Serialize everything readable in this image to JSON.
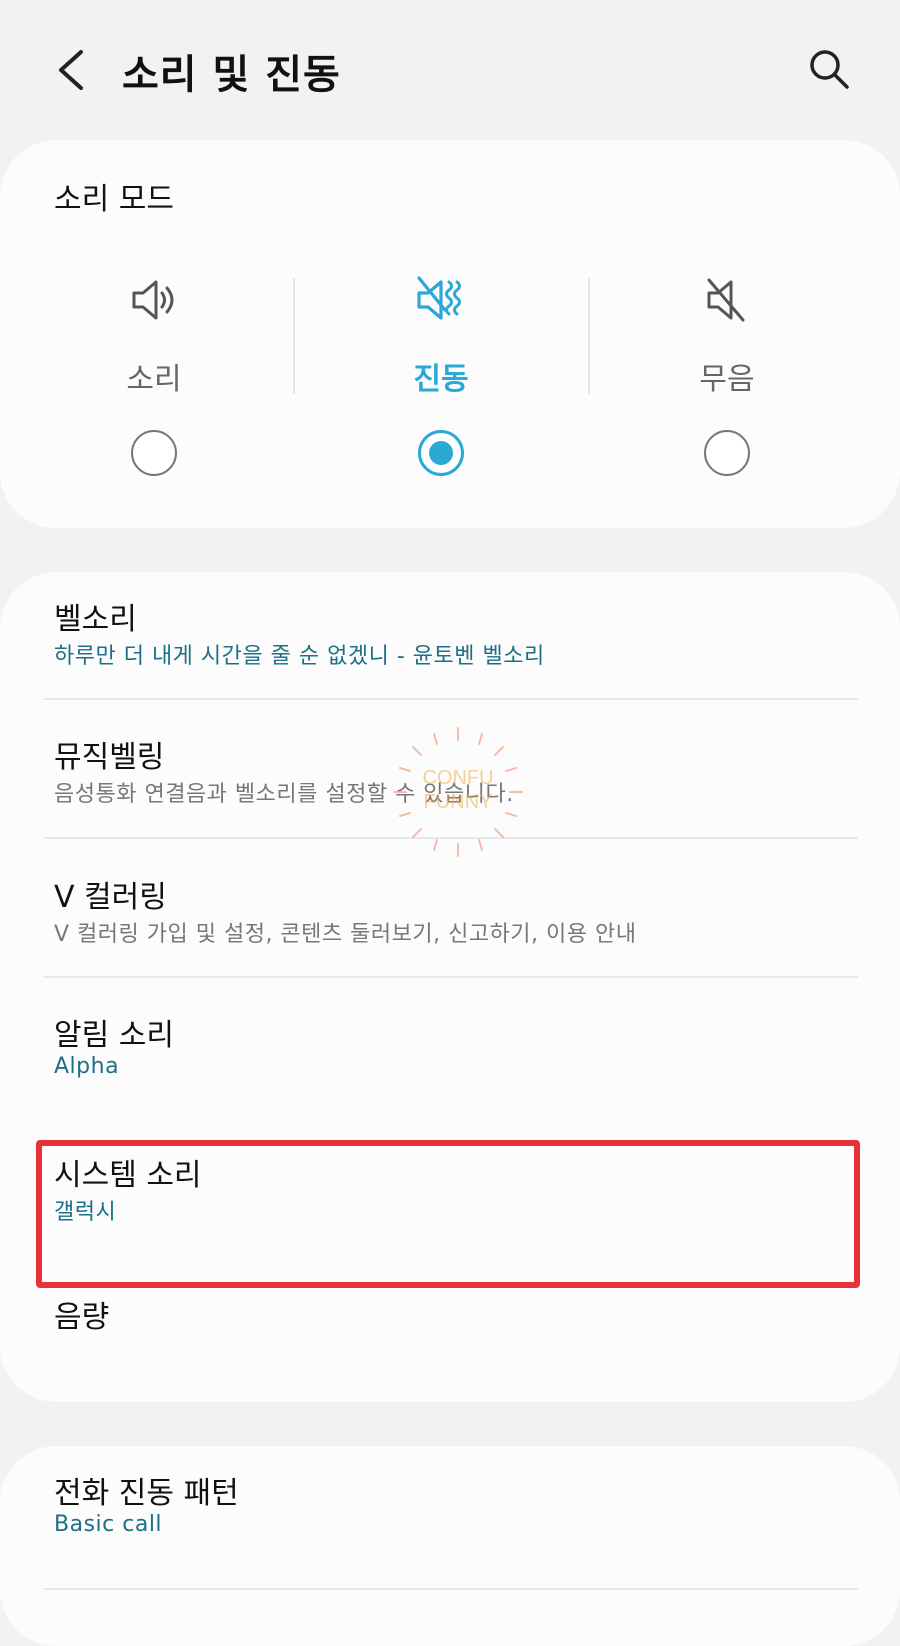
{
  "header": {
    "title": "소리 및 진동",
    "back_icon": "chevron-left-icon",
    "search_icon": "search-icon"
  },
  "sound_mode": {
    "title": "소리 모드",
    "options": [
      {
        "label": "소리",
        "icon": "speaker-icon",
        "selected": false
      },
      {
        "label": "진동",
        "icon": "vibrate-icon",
        "selected": true
      },
      {
        "label": "무음",
        "icon": "mute-icon",
        "selected": false
      }
    ],
    "accent": "#2aa8d6"
  },
  "settings": {
    "items": [
      {
        "title": "벨소리",
        "subtitle": "하루만 더 내게 시간을 줄 순 없겠니 - 윤토벤 벨소리",
        "subtitle_style": "blue"
      },
      {
        "title": "뮤직벨링",
        "subtitle": "음성통화 연결음과 벨소리를 설정할 수 있습니다.",
        "subtitle_style": "gray"
      },
      {
        "title": "V 컬러링",
        "subtitle": "V 컬러링 가입 및 설정, 콘텐츠 둘러보기, 신고하기, 이용 안내",
        "subtitle_style": "gray"
      },
      {
        "title": "알림 소리",
        "subtitle": "Alpha",
        "subtitle_style": "blue"
      },
      {
        "title": "시스템 소리",
        "subtitle": "갤럭시",
        "subtitle_style": "blue"
      },
      {
        "title": "음량",
        "subtitle": "",
        "subtitle_style": "gray"
      }
    ],
    "highlight_color": "#e8323a"
  },
  "vibration": {
    "items": [
      {
        "title": "전화 진동 패턴",
        "subtitle": "Basic call"
      }
    ]
  },
  "watermark": {
    "line1": "CONFU",
    "line2": "FUNNY"
  }
}
